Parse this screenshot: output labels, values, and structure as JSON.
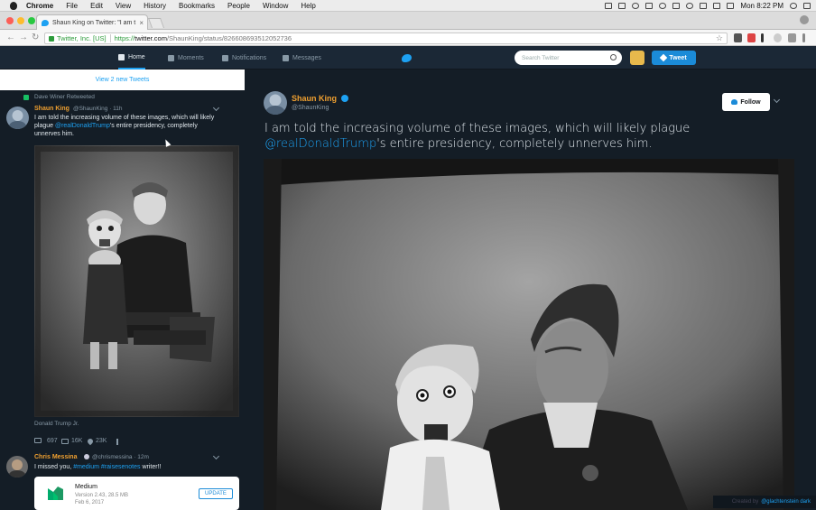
{
  "menubar": {
    "app": "Chrome",
    "items": [
      "File",
      "Edit",
      "View",
      "History",
      "Bookmarks",
      "People",
      "Window",
      "Help"
    ],
    "clock": "Mon 8:22 PM"
  },
  "browser": {
    "tab_title": "Shaun King on Twitter: \"I am t",
    "tab_close": "×",
    "cert_name": "Twitter, Inc. [US]",
    "url_protocol": "https://",
    "url_host": "twitter.com",
    "url_path": "/ShaunKing/status/826608693512052736"
  },
  "twitter_nav": {
    "items": [
      {
        "label": "Home",
        "icon": "home-icon"
      },
      {
        "label": "Moments",
        "icon": "lightning-icon"
      },
      {
        "label": "Notifications",
        "icon": "bell-icon"
      },
      {
        "label": "Messages",
        "icon": "envelope-icon"
      }
    ],
    "search_placeholder": "Search Twitter",
    "tweet_label": "Tweet"
  },
  "timeline": {
    "new_tweets": "View 2 new Tweets",
    "retweet_by": "Dave Winer Retweeted",
    "tweet1": {
      "name": "Shaun King",
      "handle": "@ShaunKing · 11h",
      "text_line1": "I am told the increasing volume of these images, which will likely",
      "text_line2_pre": "plague ",
      "text_line2_mention": "@realDonaldTrump",
      "text_line2_post": "'s entire presidency, completely",
      "text_line3": "unnerves him.",
      "image_alt": "Donald Trump Jr.",
      "replies": "",
      "retweets": "697",
      "retweet_count": "16K",
      "likes": "23K"
    },
    "tweet2": {
      "name": "Chris Messina",
      "handle": "@chrismessina · 12m",
      "text_pre": "I missed you, ",
      "text_tags": "#medium #raisesenotes",
      "text_post": " writer!!",
      "card_title": "Medium",
      "card_version": "Version 2.43, 28.5 MB",
      "card_date": "Feb 6, 2017",
      "card_button": "UPDATE"
    }
  },
  "detail": {
    "name": "Shaun King",
    "handle": "@ShaunKing",
    "follow": "Follow",
    "text_pre": "I am told the increasing volume of these images, which will likely plague ",
    "text_mention": "@realDonaldTrump",
    "text_post": "'s entire presidency, completely unnerves him.",
    "caption_pre": "Created by",
    "caption_handle": "@glachtenstein dark"
  },
  "colors": {
    "twitter_blue": "#1da1f2",
    "bg_dark": "#141d26",
    "nav_dark": "#1b2836",
    "name_orange": "#f0a030"
  }
}
